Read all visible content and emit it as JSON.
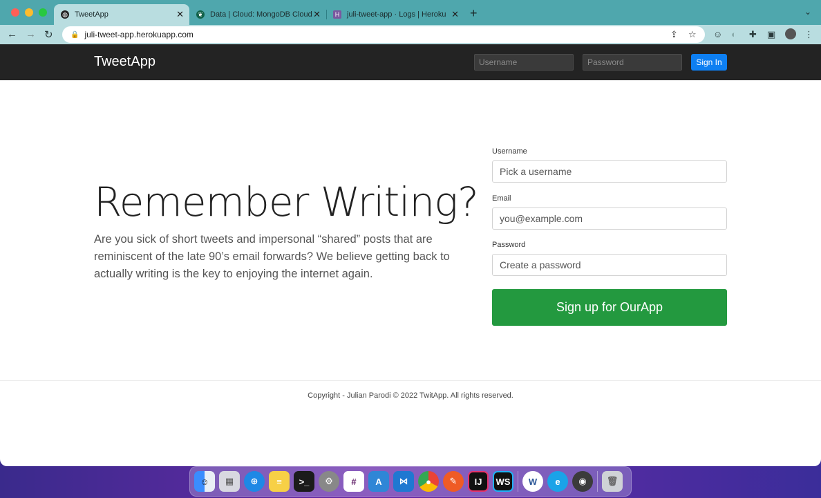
{
  "browser": {
    "tabs": [
      {
        "title": "TweetApp",
        "active": true
      },
      {
        "title": "Data | Cloud: MongoDB Cloud",
        "active": false
      },
      {
        "title": "juli-tweet-app · Logs | Heroku",
        "active": false
      }
    ],
    "url": "juli-tweet-app.herokuapp.com"
  },
  "site_header": {
    "brand": "TweetApp",
    "username_placeholder": "Username",
    "password_placeholder": "Password",
    "signin_label": "Sign In"
  },
  "hero": {
    "title": "Remember Writing?",
    "text": "Are you sick of short tweets and impersonal “shared” posts that are reminiscent of the late 90’s email forwards? We believe getting back to actually writing is the key to enjoying the internet again."
  },
  "signup_form": {
    "username_label": "Username",
    "username_placeholder": "Pick a username",
    "email_label": "Email",
    "email_placeholder": "you@example.com",
    "password_label": "Password",
    "password_placeholder": "Create a password",
    "submit_label": "Sign up for OurApp"
  },
  "footer": {
    "copyright": "Copyright - Julian Parodi © 2022 TwitApp. All rights reserved."
  },
  "dock": {
    "apps": [
      "finder",
      "launchpad",
      "safari",
      "notes",
      "terminal",
      "system-preferences",
      "slack",
      "appstore",
      "vscode",
      "chrome",
      "postman",
      "intellij",
      "webstorm",
      "word",
      "edge",
      "quicktime",
      "trash"
    ]
  },
  "colors": {
    "tabbar": "#4fa7ad",
    "site_header": "#232323",
    "signin_button": "#0d7ff2",
    "signup_button": "#23993f"
  }
}
